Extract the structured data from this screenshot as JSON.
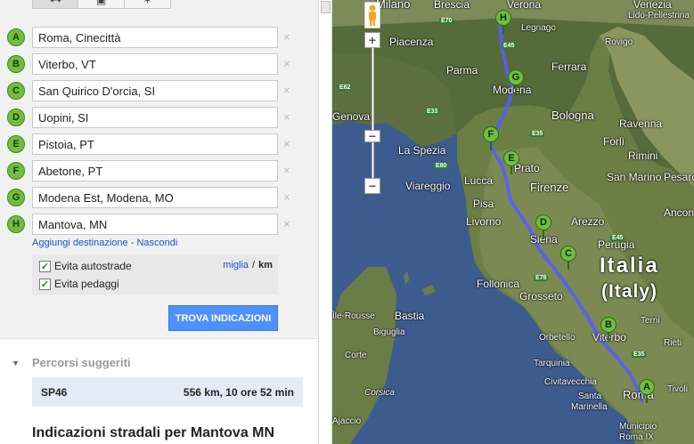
{
  "travel_modes": [
    {
      "icon": "car-icon",
      "glyph": "⛟"
    },
    {
      "icon": "bus-icon",
      "glyph": "▣"
    },
    {
      "icon": "walk-icon",
      "glyph": "✶"
    }
  ],
  "waypoints": [
    {
      "letter": "A",
      "value": "Roma, Cinecittà"
    },
    {
      "letter": "B",
      "value": "Viterbo, VT"
    },
    {
      "letter": "C",
      "value": "San Quirico D'orcia, SI"
    },
    {
      "letter": "D",
      "value": "Uopini, SI"
    },
    {
      "letter": "E",
      "value": "Pistoia, PT"
    },
    {
      "letter": "F",
      "value": "Abetone, PT"
    },
    {
      "letter": "G",
      "value": "Modena Est, Modena, MO"
    },
    {
      "letter": "H",
      "value": "Mantova, MN"
    }
  ],
  "remove_glyph": "×",
  "links": {
    "add_destination": "Aggiungi destinazione",
    "separator": "-",
    "hide": "Nascondi"
  },
  "options": {
    "avoid_highways": "Evita autostrade",
    "avoid_tolls": "Evita pedaggi",
    "check_glyph": "✓",
    "units_miles": "miglia",
    "units_sep": "/",
    "units_km": "km"
  },
  "find_button": "TROVA INDICAZIONI",
  "suggested": {
    "title": "Percorsi suggeriti",
    "route_name": "SP46",
    "route_info": "556 km, 10 ore 52 min"
  },
  "directions_title": "Indicazioni stradali per Mantova MN",
  "map": {
    "zoom_in": "+",
    "zoom_out": "−",
    "labels": {
      "milano": "Milano",
      "brescia": "Brescia",
      "verona": "Verona",
      "venezia": "Venezia",
      "lido": "Lido-Pellestrina",
      "legnago": "Legnago",
      "rovigo": "Rovigo",
      "piacenza": "Piacenza",
      "parma": "Parma",
      "ferrara": "Ferrara",
      "modena": "Modena",
      "bologna": "Bologna",
      "ravenna": "Ravenna",
      "genova": "Genova",
      "laspezia": "La Spezia",
      "forli": "Forlì",
      "rimini": "Rimini",
      "viareggio": "Viareggio",
      "lucca": "Lucca",
      "prato": "Prato",
      "sanmarino": "San Marino",
      "pesaro": "Pesaro",
      "pisa": "Pisa",
      "firenze": "Firenze",
      "livorno": "Livorno",
      "arezzo": "Arezzo",
      "ancona": "Ancona",
      "siena": "Siena",
      "perugia": "Perugia",
      "follonica": "Follonica",
      "grosseto": "Grosseto",
      "italia": "Italia",
      "italy": "(Italy)",
      "rousse": "Île-Rousse",
      "bastia": "Bastia",
      "biguglia": "Biguglia",
      "ajaccio": "Ajaccio",
      "corsica": "Corsica",
      "orbetello": "Orbetello",
      "viterbo": "Viterbo",
      "terni": "Terni",
      "rieti": "Rieti",
      "tarquinia": "Tarquinia",
      "civitavecchia": "Civitavecchia",
      "tivoli": "Tivoli",
      "santamarinella": "Santa",
      "santamarinella2": "Marinella",
      "roma": "Roma",
      "municipio": "Municipio",
      "romaix": "Roma IX",
      "corte": "Corte"
    },
    "roads": [
      "E70",
      "E45",
      "E62",
      "E33",
      "E35",
      "E80",
      "E45",
      "E78",
      "E35"
    ]
  }
}
